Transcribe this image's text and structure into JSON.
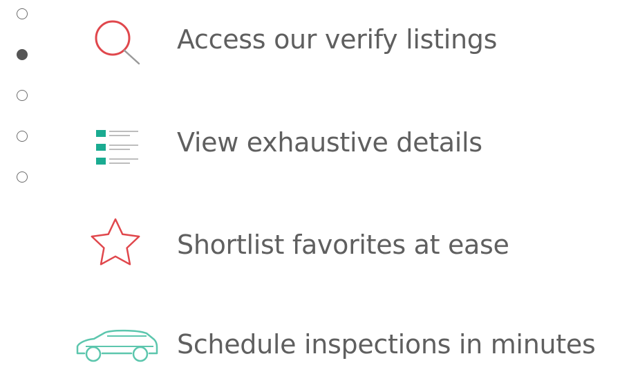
{
  "pagination": {
    "total": 5,
    "active_index": 1
  },
  "features": [
    {
      "icon": "search-icon",
      "label": "Access our verify listings",
      "color": "#e0474c"
    },
    {
      "icon": "list-details-icon",
      "label": "View exhaustive details",
      "color": "#1aab91"
    },
    {
      "icon": "star-icon",
      "label": "Shortlist favorites at ease",
      "color": "#e0474c"
    },
    {
      "icon": "car-icon",
      "label": "Schedule inspections in minutes",
      "color": "#5cc6ad"
    }
  ]
}
